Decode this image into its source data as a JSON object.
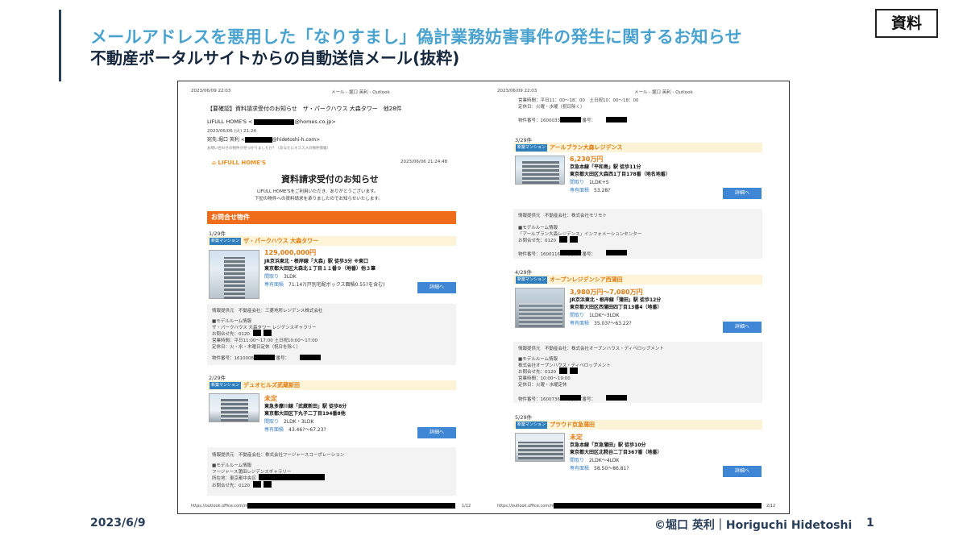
{
  "slide": {
    "title": "メールアドレスを悪用した「なりすまし」偽計業務妨害事件の発生に関するお知らせ",
    "subtitle": "不動産ポータルサイトからの自動送信メール(抜粋)",
    "badge": "資料",
    "date": "2023/6/9",
    "copyright": "©堀口 英利｜Horiguchi Hidetoshi",
    "page_number": "1"
  },
  "colors": {
    "title_blue": "#4aa3cf",
    "navy": "#15273d",
    "orange": "#ef6c1a",
    "price_orange": "#e07a10",
    "button_blue": "#3f86d4"
  },
  "page1": {
    "print_time": "2023/06/09 22:03",
    "print_header": "メール - 堀口 英利 - Outlook",
    "subject": "【要確認】資料請求受付のお知らせ　ザ・パークハウス 大森タワー　他28件",
    "from_prefix": "LIFULL HOME'S <",
    "from_suffix": "@homes.co.jp>",
    "sent_date": "2023/06/06 (火) 21:24",
    "to_prefix": "宛先:堀口 英利 <",
    "to_suffix": "@hidetoshi-h.com>",
    "preview": "お問い合わせの物件が見つかりましたか？（あなたにオススメの物件情報）",
    "logo_text": "LIFULL HOME'S",
    "mail_timestamp": "2023/06/06 21:24:48",
    "notice_title": "資料請求受付のお知らせ",
    "notice_line1": "LIFULL HOME'Sをご利用いただき、ありがとうございます。",
    "notice_line2": "下記の物件への資料請求を承りましたのでお知らせいたします。",
    "section_title": "お問合せ物件",
    "footer_url": "https://outlook.office.com/mail/",
    "footer_page": "1/12",
    "items": [
      {
        "count": "1/29件",
        "tag": "新築マンション",
        "name": "ザ・パークハウス 大森タワー",
        "price": "129,000,000円",
        "line1": "JR京浜東北・根岸線「大森」駅 徒歩3分 ※東口",
        "line2": "東京都大田区大森北１丁目１１番９（地番）他３筆",
        "layout_label": "間取り",
        "layout": "3LDK",
        "area_label": "専有面積",
        "area": "71.14?(戸別宅配ボックス面積0.55?を含む)",
        "button": "詳細へ",
        "info1": "情報提供元　不動産会社：三菱地所レジデンス株式会社",
        "info2": "■モデルルーム情報",
        "info3": "ザ・パークハウス 大森タワー レジデンスギャラリー",
        "info4": "お問合せ先：0120",
        "info5": "営業時間：平日11:00〜17:00 土日祝10:00〜17:00",
        "info6": "定休日：火・水・木曜日定休（祝日を除く）",
        "ids": "物件番号：1610008　　問合せ番号："
      },
      {
        "count": "2/29件",
        "tag": "新築マンション",
        "name": "デュオヒルズ武蔵新田",
        "price": "未定",
        "line1": "東急多摩川線「武蔵新田」駅 徒歩8分",
        "line2": "東京都大田区下丸子二丁目194番8他",
        "layout_label": "間取り",
        "layout": "2LDK・3LDK",
        "area_label": "専有面積",
        "area": "43.46?〜67.23?",
        "button": "詳細へ",
        "info1": "情報提供元　不動産会社：株式会社フージャースコーポレーション",
        "info2": "■モデルルーム情報",
        "info3": "フージャース蒲田レジデンスギャラリー",
        "info4": "所在地：東京都中央区",
        "info5": "お問合せ先：0120"
      }
    ]
  },
  "page2": {
    "print_time": "2023/06/09 22:03",
    "print_header": "メール - 堀口 英利 - Outlook",
    "top1": "営業時間：平日11：00〜18：00　土日祝10：00〜18：00",
    "top2": "定休日：火曜・水曜（祝日除く）",
    "top3": "物件番号：1600033　　問合せ番号：",
    "footer_url": "https://outlook.office.com/mail/",
    "footer_page": "2/12",
    "items": [
      {
        "count": "3/29件",
        "tag": "新築マンション",
        "name": "アールブラン大森レジデンス",
        "price": "6,230万円",
        "line1": "京急本線「平和島」駅 徒歩11分",
        "line2": "東京都大田区大森西1丁目178番（地名地番）",
        "layout_label": "間取り",
        "layout": "1LDK+S",
        "area_label": "専有面積",
        "area": "53.28?",
        "button": "詳細へ",
        "info1": "情報提供元　不動産会社：株式会社モリモト",
        "info2": "■モデルルーム情報",
        "info3": "「アールブラン大森レジデンス」インフォメーションセンター",
        "info4": "お問合せ先：0120",
        "ids": "物件番号：1600116　　問合せ番号："
      },
      {
        "count": "4/29件",
        "tag": "新築マンション",
        "name": "オープンレジデンシア西蒲田",
        "price": "3,980万円〜7,080万円",
        "line1": "JR京浜東北・根岸線「蒲田」駅 徒歩12分",
        "line2": "東京都大田区西蒲田四丁目13番4（地番）",
        "layout_label": "間取り",
        "layout": "1LDK〜3LDK",
        "area_label": "専有面積",
        "area": "35.03?〜63.22?",
        "button": "詳細へ",
        "info1": "情報提供元　不動産会社：株式会社オープンハウス・ディベロップメント",
        "info2": "■モデルルーム情報",
        "info3": "株式会社オープンハウス・ディベロップメント",
        "info4": "お問合せ先：0120",
        "info5": "営業時間：10:00〜19:00",
        "info6": "定休日：火曜・水曜定休",
        "ids": "物件番号：1600736　　問合せ番号："
      },
      {
        "count": "5/29件",
        "tag": "新築マンション",
        "name": "プラウド京急蒲田",
        "price": "未定",
        "line1": "京急本線「京急蒲田」駅 徒歩10分",
        "line2": "東京都大田区北糀谷二丁目367番（地番）",
        "layout_label": "間取り",
        "layout": "2LDK〜4LDK",
        "area_label": "専有面積",
        "area": "58.50〜86.81?",
        "button": "詳細へ"
      }
    ]
  }
}
